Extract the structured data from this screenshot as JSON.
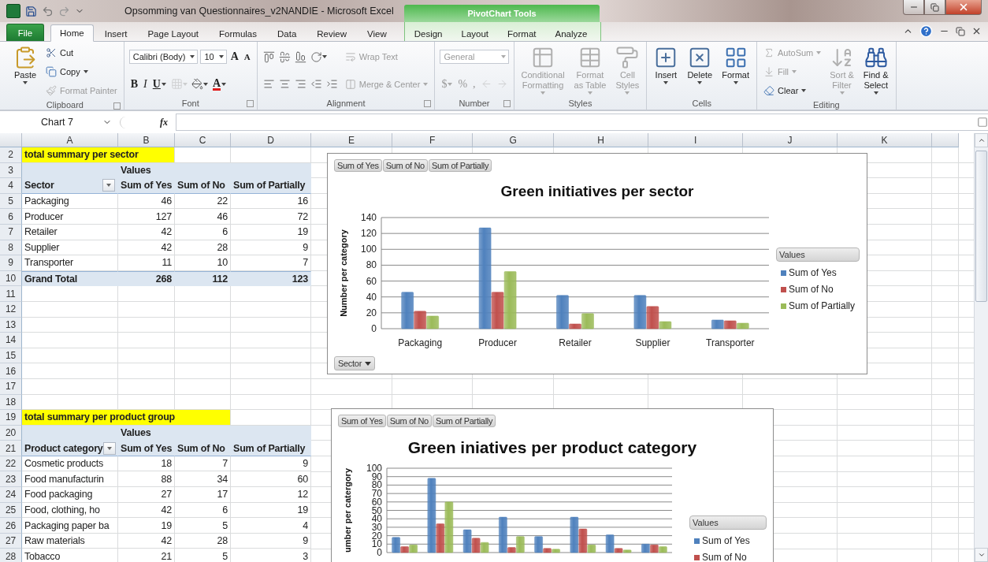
{
  "title_bar": {
    "title": "Opsomming van Questionnaires_v2NANDIE  -  Microsoft Excel",
    "context_group": "PivotChart Tools"
  },
  "tabs": [
    {
      "label": "File",
      "kind": "file",
      "selected": false
    },
    {
      "label": "Home",
      "kind": "standard",
      "selected": true
    },
    {
      "label": "Insert",
      "kind": "standard",
      "selected": false
    },
    {
      "label": "Page Layout",
      "kind": "standard",
      "selected": false
    },
    {
      "label": "Formulas",
      "kind": "standard",
      "selected": false
    },
    {
      "label": "Data",
      "kind": "standard",
      "selected": false
    },
    {
      "label": "Review",
      "kind": "standard",
      "selected": false
    },
    {
      "label": "View",
      "kind": "standard",
      "selected": false
    },
    {
      "label": "Design",
      "kind": "contextual",
      "selected": false
    },
    {
      "label": "Layout",
      "kind": "contextual",
      "selected": false
    },
    {
      "label": "Format",
      "kind": "contextual",
      "selected": false
    },
    {
      "label": "Analyze",
      "kind": "contextual",
      "selected": false
    }
  ],
  "ribbon": [
    {
      "label": "Clipboard",
      "launcher": true,
      "columns": [
        [
          [
            {
              "kind": "large",
              "label": "Paste",
              "dropdown": true,
              "disabled": false
            }
          ]
        ],
        [
          [
            {
              "kind": "small",
              "label": "Cut",
              "dropdown": false,
              "disabled": false
            }
          ],
          [
            {
              "kind": "small",
              "label": "Copy",
              "dropdown": true,
              "disabled": false
            }
          ],
          [
            {
              "kind": "small",
              "label": "Format Painter",
              "dropdown": false,
              "disabled": true
            }
          ]
        ]
      ]
    },
    {
      "label": "Font",
      "launcher": true,
      "columns": [
        [
          [
            {
              "kind": "field",
              "label": "Calibri (Body)",
              "dropdown": true,
              "disabled": false
            },
            {
              "kind": "field",
              "label": "10",
              "dropdown": true,
              "disabled": false
            },
            {
              "kind": "glyph",
              "label": "A",
              "dropdown": false,
              "disabled": false
            },
            {
              "kind": "glyph",
              "label": "A",
              "dropdown": false,
              "disabled": false
            }
          ],
          [
            {
              "kind": "glyph",
              "label": "B",
              "dropdown": false,
              "disabled": false
            },
            {
              "kind": "glyph",
              "label": "I",
              "dropdown": false,
              "disabled": false
            },
            {
              "kind": "glyph",
              "label": "U",
              "dropdown": true,
              "disabled": false
            },
            {
              "kind": "icon",
              "dropdown": true,
              "disabled": true
            },
            {
              "kind": "icon",
              "dropdown": true,
              "disabled": false
            },
            {
              "kind": "glyph",
              "label": "A",
              "dropdown": true,
              "disabled": false
            }
          ]
        ]
      ]
    },
    {
      "label": "Alignment",
      "launcher": true,
      "columns": [
        [
          [
            {
              "kind": "icon",
              "dropdown": false,
              "disabled": false
            },
            {
              "kind": "icon",
              "dropdown": false,
              "disabled": false
            },
            {
              "kind": "icon",
              "dropdown": false,
              "disabled": false
            },
            {
              "kind": "icon",
              "dropdown": true,
              "disabled": false
            }
          ],
          [
            {
              "kind": "icon",
              "dropdown": false,
              "disabled": false
            },
            {
              "kind": "icon",
              "dropdown": false,
              "disabled": false
            },
            {
              "kind": "icon",
              "dropdown": false,
              "disabled": false
            },
            {
              "kind": "icon",
              "dropdown": false,
              "disabled": false
            },
            {
              "kind": "icon",
              "dropdown": false,
              "disabled": false
            }
          ]
        ],
        [
          [
            {
              "kind": "small",
              "label": "Wrap Text",
              "dropdown": false,
              "disabled": true
            }
          ],
          [
            {
              "kind": "small",
              "label": "Merge & Center",
              "dropdown": true,
              "disabled": true
            }
          ]
        ]
      ]
    },
    {
      "label": "Number",
      "launcher": true,
      "columns": [
        [
          [
            {
              "kind": "field",
              "label": "General",
              "dropdown": true,
              "disabled": true
            }
          ],
          [
            {
              "kind": "glyph",
              "label": "$",
              "dropdown": true,
              "disabled": true
            },
            {
              "kind": "glyph",
              "label": "%",
              "dropdown": false,
              "disabled": true
            },
            {
              "kind": "glyph",
              "label": ",",
              "dropdown": false,
              "disabled": true
            },
            {
              "kind": "icon",
              "dropdown": false,
              "disabled": true
            },
            {
              "kind": "icon",
              "dropdown": false,
              "disabled": true
            }
          ]
        ]
      ]
    },
    {
      "label": "Styles",
      "launcher": false,
      "columns": [
        [
          [
            {
              "kind": "large",
              "label": "Conditional\nFormatting",
              "dropdown": true,
              "disabled": true
            }
          ]
        ],
        [
          [
            {
              "kind": "large",
              "label": "Format\nas Table",
              "dropdown": true,
              "disabled": true
            }
          ]
        ],
        [
          [
            {
              "kind": "large",
              "label": "Cell\nStyles",
              "dropdown": true,
              "disabled": true
            }
          ]
        ]
      ]
    },
    {
      "label": "Cells",
      "launcher": false,
      "columns": [
        [
          [
            {
              "kind": "large",
              "label": "Insert",
              "dropdown": true,
              "disabled": false
            }
          ]
        ],
        [
          [
            {
              "kind": "large",
              "label": "Delete",
              "dropdown": true,
              "disabled": false
            }
          ]
        ],
        [
          [
            {
              "kind": "large",
              "label": "Format",
              "dropdown": true,
              "disabled": false
            }
          ]
        ]
      ]
    },
    {
      "label": "Editing",
      "launcher": false,
      "columns": [
        [
          [
            {
              "kind": "small",
              "label": "AutoSum",
              "dropdown": true,
              "disabled": true
            }
          ],
          [
            {
              "kind": "small",
              "label": "Fill",
              "dropdown": true,
              "disabled": true
            }
          ],
          [
            {
              "kind": "small",
              "label": "Clear",
              "dropdown": true,
              "disabled": false
            }
          ]
        ],
        [
          [
            {
              "kind": "large",
              "label": "Sort &\nFilter",
              "dropdown": true,
              "disabled": true
            }
          ]
        ],
        [
          [
            {
              "kind": "large",
              "label": "Find &\nSelect",
              "dropdown": true,
              "disabled": false
            }
          ]
        ]
      ]
    }
  ],
  "formula_bar": {
    "name_box": "Chart 7",
    "fx": "fx"
  },
  "sheet": {
    "columns": [
      "A",
      "B",
      "C",
      "D",
      "E",
      "F",
      "G",
      "H",
      "I",
      "J",
      "K"
    ],
    "rows": [
      {
        "number": "2",
        "kind": "caption",
        "text": "total summary per sector"
      },
      {
        "number": "3",
        "kind": "values",
        "text": "Values"
      },
      {
        "number": "4",
        "kind": "header",
        "field": "Sector",
        "columns": [
          "Sum of Yes",
          "Sum of No",
          "Sum of Partially"
        ]
      },
      {
        "number": "5",
        "kind": "data",
        "label": "Packaging",
        "values": [
          "46",
          "22",
          "16"
        ]
      },
      {
        "number": "6",
        "kind": "data",
        "label": "Producer",
        "values": [
          "127",
          "46",
          "72"
        ]
      },
      {
        "number": "7",
        "kind": "data",
        "label": "Retailer",
        "values": [
          "42",
          "6",
          "19"
        ]
      },
      {
        "number": "8",
        "kind": "data",
        "label": "Supplier",
        "values": [
          "42",
          "28",
          "9"
        ]
      },
      {
        "number": "9",
        "kind": "data",
        "label": "Transporter",
        "values": [
          "11",
          "10",
          "7"
        ]
      },
      {
        "number": "10",
        "kind": "total",
        "label": "Grand Total",
        "values": [
          "268",
          "112",
          "123"
        ]
      },
      {
        "number": "11",
        "kind": "blank"
      },
      {
        "number": "12",
        "kind": "blank"
      },
      {
        "number": "13",
        "kind": "blank"
      },
      {
        "number": "14",
        "kind": "blank"
      },
      {
        "number": "15",
        "kind": "blank"
      },
      {
        "number": "16",
        "kind": "blank"
      },
      {
        "number": "17",
        "kind": "blank"
      },
      {
        "number": "18",
        "kind": "blank"
      },
      {
        "number": "19",
        "kind": "caption",
        "text": "total summary per product group"
      },
      {
        "number": "20",
        "kind": "values",
        "text": "Values"
      },
      {
        "number": "21",
        "kind": "header",
        "field": "Product category",
        "columns": [
          "Sum of Yes",
          "Sum of No",
          "Sum of Partially"
        ]
      },
      {
        "number": "22",
        "kind": "data",
        "label": "Cosmetic products",
        "values": [
          "18",
          "7",
          "9"
        ]
      },
      {
        "number": "23",
        "kind": "data",
        "label": "Food manufacturin",
        "values": [
          "88",
          "34",
          "60"
        ]
      },
      {
        "number": "24",
        "kind": "data",
        "label": "Food packaging",
        "values": [
          "27",
          "17",
          "12"
        ]
      },
      {
        "number": "25",
        "kind": "data",
        "label": "Food, clothing, ho",
        "values": [
          "42",
          "6",
          "19"
        ]
      },
      {
        "number": "26",
        "kind": "data",
        "label": "Packaging paper ba",
        "values": [
          "19",
          "5",
          "4"
        ]
      },
      {
        "number": "27",
        "kind": "data",
        "label": "Raw materials",
        "values": [
          "42",
          "28",
          "9"
        ]
      },
      {
        "number": "28",
        "kind": "data",
        "label": "Tobacco",
        "values": [
          "21",
          "5",
          "3"
        ]
      }
    ]
  },
  "charts": [
    {
      "field_buttons": [
        "Sum of Yes",
        "Sum of No",
        "Sum of Partially"
      ],
      "axis_field_button": "Sector",
      "legend_title": "Values",
      "chart_data": {
        "type": "bar",
        "title": "Green initiatives per sector",
        "ylabel": "Number per category",
        "categories": [
          "Packaging",
          "Producer",
          "Retailer",
          "Supplier",
          "Transporter"
        ],
        "series": [
          {
            "name": "Sum of Yes",
            "color": "#4f81bd",
            "values": [
              46,
              127,
              42,
              42,
              11
            ]
          },
          {
            "name": "Sum of No",
            "color": "#c0504d",
            "values": [
              22,
              46,
              6,
              28,
              10
            ]
          },
          {
            "name": "Sum of Partially",
            "color": "#9bbb59",
            "values": [
              16,
              72,
              19,
              9,
              7
            ]
          }
        ],
        "ylim": [
          0,
          140
        ],
        "yticks": [
          0,
          20,
          40,
          60,
          80,
          100,
          120,
          140
        ],
        "grid": true
      }
    },
    {
      "field_buttons": [
        "Sum of Yes",
        "Sum of No",
        "Sum of Partially"
      ],
      "legend_title": "Values",
      "chart_data": {
        "type": "bar",
        "title": "Green iniatives per product category",
        "ylabel": "umber per catergory",
        "series": [
          {
            "name": "Sum of Yes",
            "color": "#4f81bd",
            "values": [
              18,
              88,
              27,
              42,
              19,
              42,
              21,
              10
            ]
          },
          {
            "name": "Sum of No",
            "color": "#c0504d",
            "values": [
              7,
              34,
              17,
              6,
              5,
              28,
              5,
              9
            ]
          },
          {
            "color": "#9bbb59",
            "values": [
              9,
              60,
              12,
              19,
              4,
              9,
              3,
              7
            ]
          }
        ],
        "ylim": [
          0,
          100
        ],
        "yticks": [
          0,
          10,
          20,
          30,
          40,
          50,
          60,
          70,
          80,
          90,
          100
        ],
        "grid": true
      }
    }
  ]
}
